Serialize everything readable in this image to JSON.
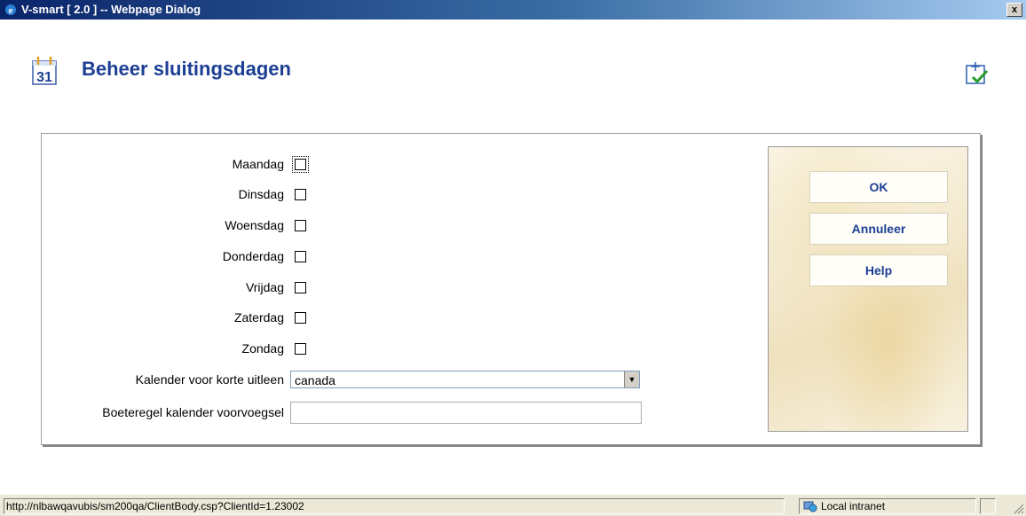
{
  "window": {
    "title": "V-smart [ 2.0 ] -- Webpage Dialog",
    "close_label": "x"
  },
  "page": {
    "title": "Beheer sluitingsdagen"
  },
  "form": {
    "days": [
      {
        "label": "Maandag",
        "checked": false
      },
      {
        "label": "Dinsdag",
        "checked": false
      },
      {
        "label": "Woensdag",
        "checked": false
      },
      {
        "label": "Donderdag",
        "checked": false
      },
      {
        "label": "Vrijdag",
        "checked": false
      },
      {
        "label": "Zaterdag",
        "checked": false
      },
      {
        "label": "Zondag",
        "checked": false
      }
    ],
    "calendar_label": "Kalender voor korte uitleen",
    "calendar_value": "canada",
    "prefix_label": "Boeteregel kalender voorvoegsel",
    "prefix_value": ""
  },
  "buttons": {
    "ok": "OK",
    "cancel": "Annuleer",
    "help": "Help"
  },
  "statusbar": {
    "url": "http://nlbawqavubis/sm200qa/ClientBody.csp?ClientId=1.23002",
    "zone": "Local intranet"
  },
  "icons": {
    "window": "ie-icon",
    "header": "calendar-icon",
    "toolbar": "checkmark-icon",
    "zone": "intranet-globe-icon"
  },
  "colors": {
    "title_text": "#1c3f94",
    "titlebar_start": "#0a246a",
    "titlebar_end": "#a6caf0",
    "button_text": "#1c3f94"
  }
}
